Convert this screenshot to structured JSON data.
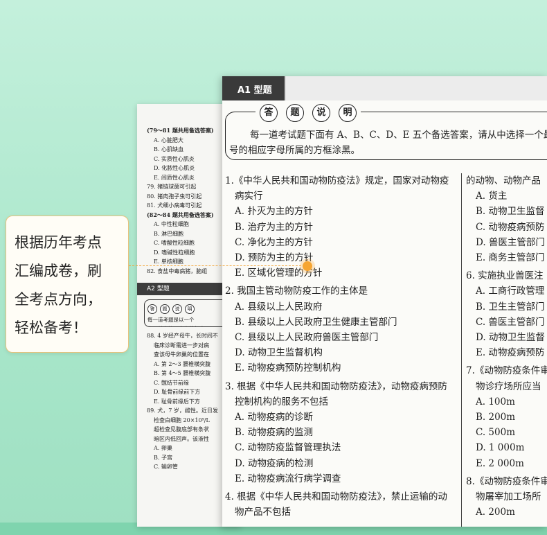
{
  "callout": {
    "lines": [
      "根据历年考点",
      "汇编成卷，刷",
      "全考点方向，",
      "轻松备考！"
    ]
  },
  "back_page": {
    "lines_top": [
      {
        "t": "(79～81 题共用备选答案)",
        "cls": "hd"
      },
      {
        "t": "A. 心脏肥大",
        "cls": "ind"
      },
      {
        "t": "B. 心肌缺血",
        "cls": "ind"
      },
      {
        "t": "C. 实质性心肌炎",
        "cls": "ind"
      },
      {
        "t": "D. 化脓性心肌炎",
        "cls": "ind"
      },
      {
        "t": "E. 间质性心肌炎",
        "cls": "ind"
      },
      {
        "t": "79. 猪链球菌可引起",
        "cls": ""
      },
      {
        "t": "80. 猪肉孢子虫可引起",
        "cls": ""
      },
      {
        "t": "81. 犬细小病毒可引起",
        "cls": ""
      },
      {
        "t": "(82～84 题共用备选答案)",
        "cls": "hd"
      },
      {
        "t": "A. 中性粒细胞",
        "cls": "ind"
      },
      {
        "t": "B. 淋巴细胞",
        "cls": "ind"
      },
      {
        "t": "C. 嗜酸性粒细胞",
        "cls": "ind"
      },
      {
        "t": "D. 嗜碱性粒细胞",
        "cls": "ind"
      },
      {
        "t": "E. 单核细胞",
        "cls": "ind"
      },
      {
        "t": "82. 食盐中毒病猪，脑组",
        "cls": ""
      }
    ],
    "a2_label": "A2 型题",
    "badges": [
      "答",
      "题",
      "说",
      "明"
    ],
    "instr_lines": [
      "每一道考题是以一个",
      "案，并在答题卡上将相应"
    ],
    "lines_bottom": [
      {
        "t": "88. 4 岁经产母牛，长时间不",
        "cls": ""
      },
      {
        "t": "临床诊断需进一步对病",
        "cls": "ind"
      },
      {
        "t": "查该母牛卵巢的位置在",
        "cls": "ind"
      },
      {
        "t": "A. 第 2～3 腰椎横突腹",
        "cls": "ind"
      },
      {
        "t": "B. 第 4～5 腰椎横突腹",
        "cls": "ind"
      },
      {
        "t": "C. 髋结节前缘",
        "cls": "ind"
      },
      {
        "t": "D. 耻骨前缘前下方",
        "cls": "ind"
      },
      {
        "t": "E. 耻骨前缘后下方",
        "cls": "ind"
      },
      {
        "t": "89. 犬，7 岁，雌性。近日发",
        "cls": ""
      },
      {
        "t": "检查白细胞 20×10⁹/L",
        "cls": "ind"
      },
      {
        "t": "超检查见腹底部有条状",
        "cls": "ind"
      },
      {
        "t": "暗区内低回声。该液性",
        "cls": "ind"
      },
      {
        "t": "A. 卵巢",
        "cls": "ind"
      },
      {
        "t": "B. 子宫",
        "cls": "ind"
      },
      {
        "t": "C. 输卵管",
        "cls": "ind"
      }
    ]
  },
  "front_page": {
    "section_label": "A1 型题",
    "badges": [
      "答",
      "题",
      "说",
      "明"
    ],
    "instructions": [
      "每一道考试题下面有 A、B、C、D、E 五个备选答案，请从中选择一个最",
      "号的相应字母所属的方框涂黑。"
    ],
    "left_questions": [
      {
        "stem": [
          "1.《中华人民共和国动物防疫法》规定，国家对动物疫",
          "病实行"
        ],
        "options": [
          "A. 扑灭为主的方针",
          "B. 治疗为主的方针",
          "C. 净化为主的方针",
          "D. 预防为主的方针",
          "E. 区域化管理的方针"
        ]
      },
      {
        "stem": [
          "2. 我国主管动物防疫工作的主体是"
        ],
        "options": [
          "A. 县级以上人民政府",
          "B. 县级以上人民政府卫生健康主管部门",
          "C. 县级以上人民政府兽医主管部门",
          "D. 动物卫生监督机构",
          "E. 动物疫病预防控制机构"
        ]
      },
      {
        "stem": [
          "3. 根据《中华人民共和国动物防疫法》，动物疫病预防",
          "控制机构的服务不包括"
        ],
        "options": [
          "A. 动物疫病的诊断",
          "B. 动物疫病的监测",
          "C. 动物防疫监督管理执法",
          "D. 动物疫病的检测",
          "E. 动物疫病流行病学调查"
        ]
      },
      {
        "stem": [
          "4. 根据《中华人民共和国动物防疫法》，禁止运输的动",
          "物产品不包括"
        ],
        "options": []
      }
    ],
    "right_lines": [
      {
        "t": "的动物、动物产品",
        "cls": "q"
      },
      {
        "t": "A. 货主",
        "cls": "opt"
      },
      {
        "t": "B. 动物卫生监督",
        "cls": "opt"
      },
      {
        "t": "C. 动物疫病预防",
        "cls": "opt"
      },
      {
        "t": "D. 兽医主管部门",
        "cls": "opt"
      },
      {
        "t": "E. 商务主管部门",
        "cls": "opt"
      },
      {
        "t": "",
        "cls": "q-gap"
      },
      {
        "t": "6. 实施执业兽医注",
        "cls": "q"
      },
      {
        "t": "A. 工商行政管理",
        "cls": "opt"
      },
      {
        "t": "B. 卫生主管部门",
        "cls": "opt"
      },
      {
        "t": "C. 兽医主管部门",
        "cls": "opt"
      },
      {
        "t": "D. 动物卫生监督",
        "cls": "opt"
      },
      {
        "t": "E. 动物疫病预防",
        "cls": "opt"
      },
      {
        "t": "",
        "cls": "q-gap"
      },
      {
        "t": "7.《动物防疫条件审",
        "cls": "q"
      },
      {
        "t": "物诊疗场所应当",
        "cls": "qcont"
      },
      {
        "t": "A. 100m",
        "cls": "opt"
      },
      {
        "t": "B. 200m",
        "cls": "opt"
      },
      {
        "t": "C. 500m",
        "cls": "opt"
      },
      {
        "t": "D. 1 000m",
        "cls": "opt"
      },
      {
        "t": "E. 2 000m",
        "cls": "opt"
      },
      {
        "t": "",
        "cls": "q-gap"
      },
      {
        "t": "8.《动物防疫条件审",
        "cls": "q"
      },
      {
        "t": "物屠宰加工场所",
        "cls": "qcont"
      },
      {
        "t": "A. 200m",
        "cls": "opt"
      }
    ]
  }
}
